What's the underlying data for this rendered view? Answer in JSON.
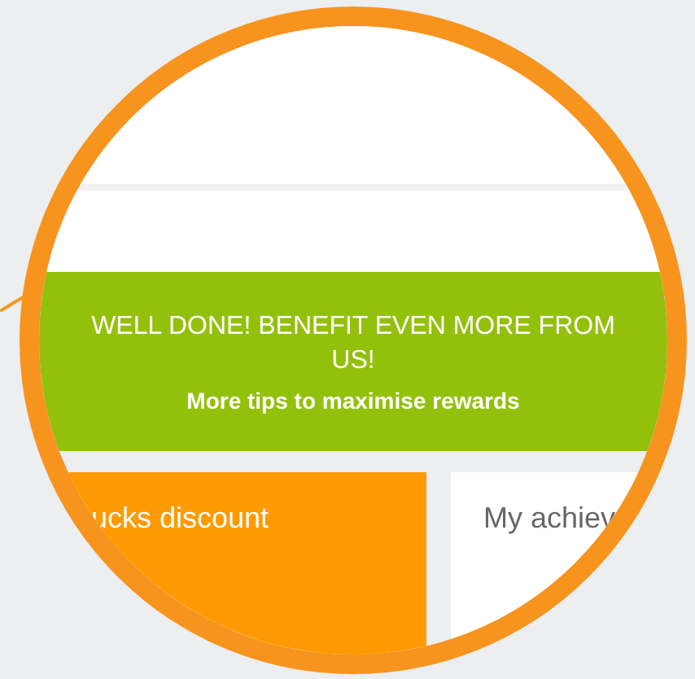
{
  "banner": {
    "title": "WELL DONE! BENEFIT EVEN MORE FROM US!",
    "subtitle": "More tips to maximise rewards"
  },
  "cards": [
    {
      "kind": "highlight",
      "title": "ucks discount"
    },
    {
      "kind": "plain",
      "title": "My achiev"
    }
  ]
}
